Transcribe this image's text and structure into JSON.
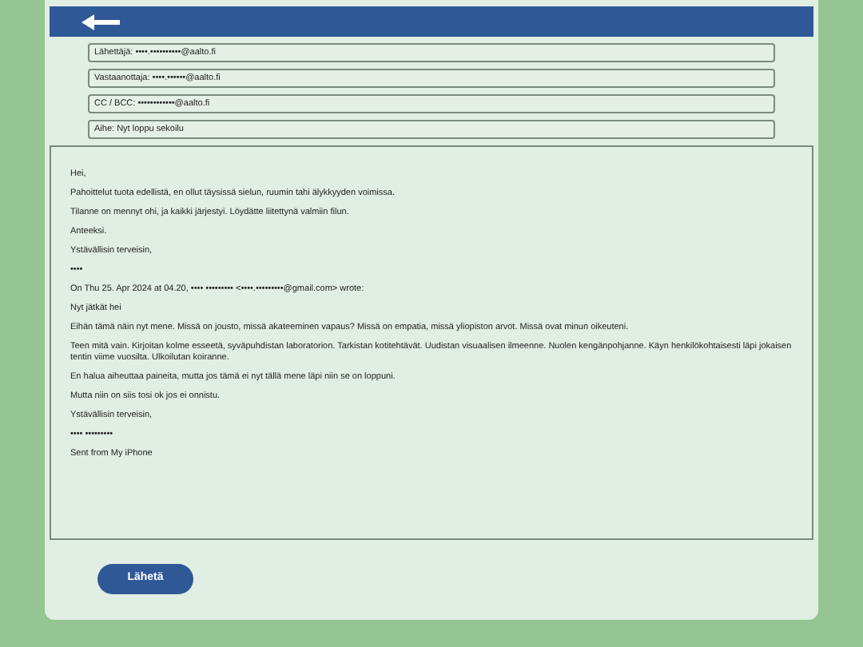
{
  "fields": [
    {
      "label": "Lähettäjä:",
      "value": "••••.••••••••••@aalto.fi"
    },
    {
      "label": "Vastaanottaja:",
      "value": "••••.••••••@aalto.fi"
    },
    {
      "label": "CC / BCC:",
      "value": "••••••••••••@aalto.fi"
    },
    {
      "label": "Aihe:",
      "value": "Nyt loppu sekoilu"
    }
  ],
  "body": [
    "Hei,",
    "Pahoittelut tuota edellistä, en ollut täysissä sielun, ruumin tahi älykkyyden voimissa.",
    "Tilanne on mennyt ohi, ja kaikki järjestyi. Löydätte liitettynä valmiin filun.",
    "Anteeksi.",
    "Ystävällisin terveisin,",
    "••••",
    "On Thu 25. Apr 2024 at 04.20, •••• ••••••••• <••••.•••••••••@gmail.com> wrote:",
    "Nyt jätkät hei",
    "Eihän tämä näin nyt mene. Missä on jousto, missä akateeminen vapaus? Missä on empatia, missä yliopiston arvot. Missä ovat minun oikeuteni.",
    "Teen mitä vain. Kirjoitan kolme esseetä, syväpuhdistan laboratorion. Tarkistan kotitehtävät. Uudistan visuaalisen ilmeenne. Nuolen kengänpohjanne. Käyn henkilökohtaisesti läpi jokaisen tentin viime vuosilta. Ulkoilutan koiranne.",
    "En halua aiheuttaa paineita, mutta jos tämä ei nyt tällä mene läpi niin se on loppuni.",
    "Mutta niin on siis tosi ok jos ei onnistu.",
    "Ystävällisin terveisin,",
    "•••• •••••••••",
    "Sent from My iPhone"
  ],
  "send_button": "Lähetä"
}
